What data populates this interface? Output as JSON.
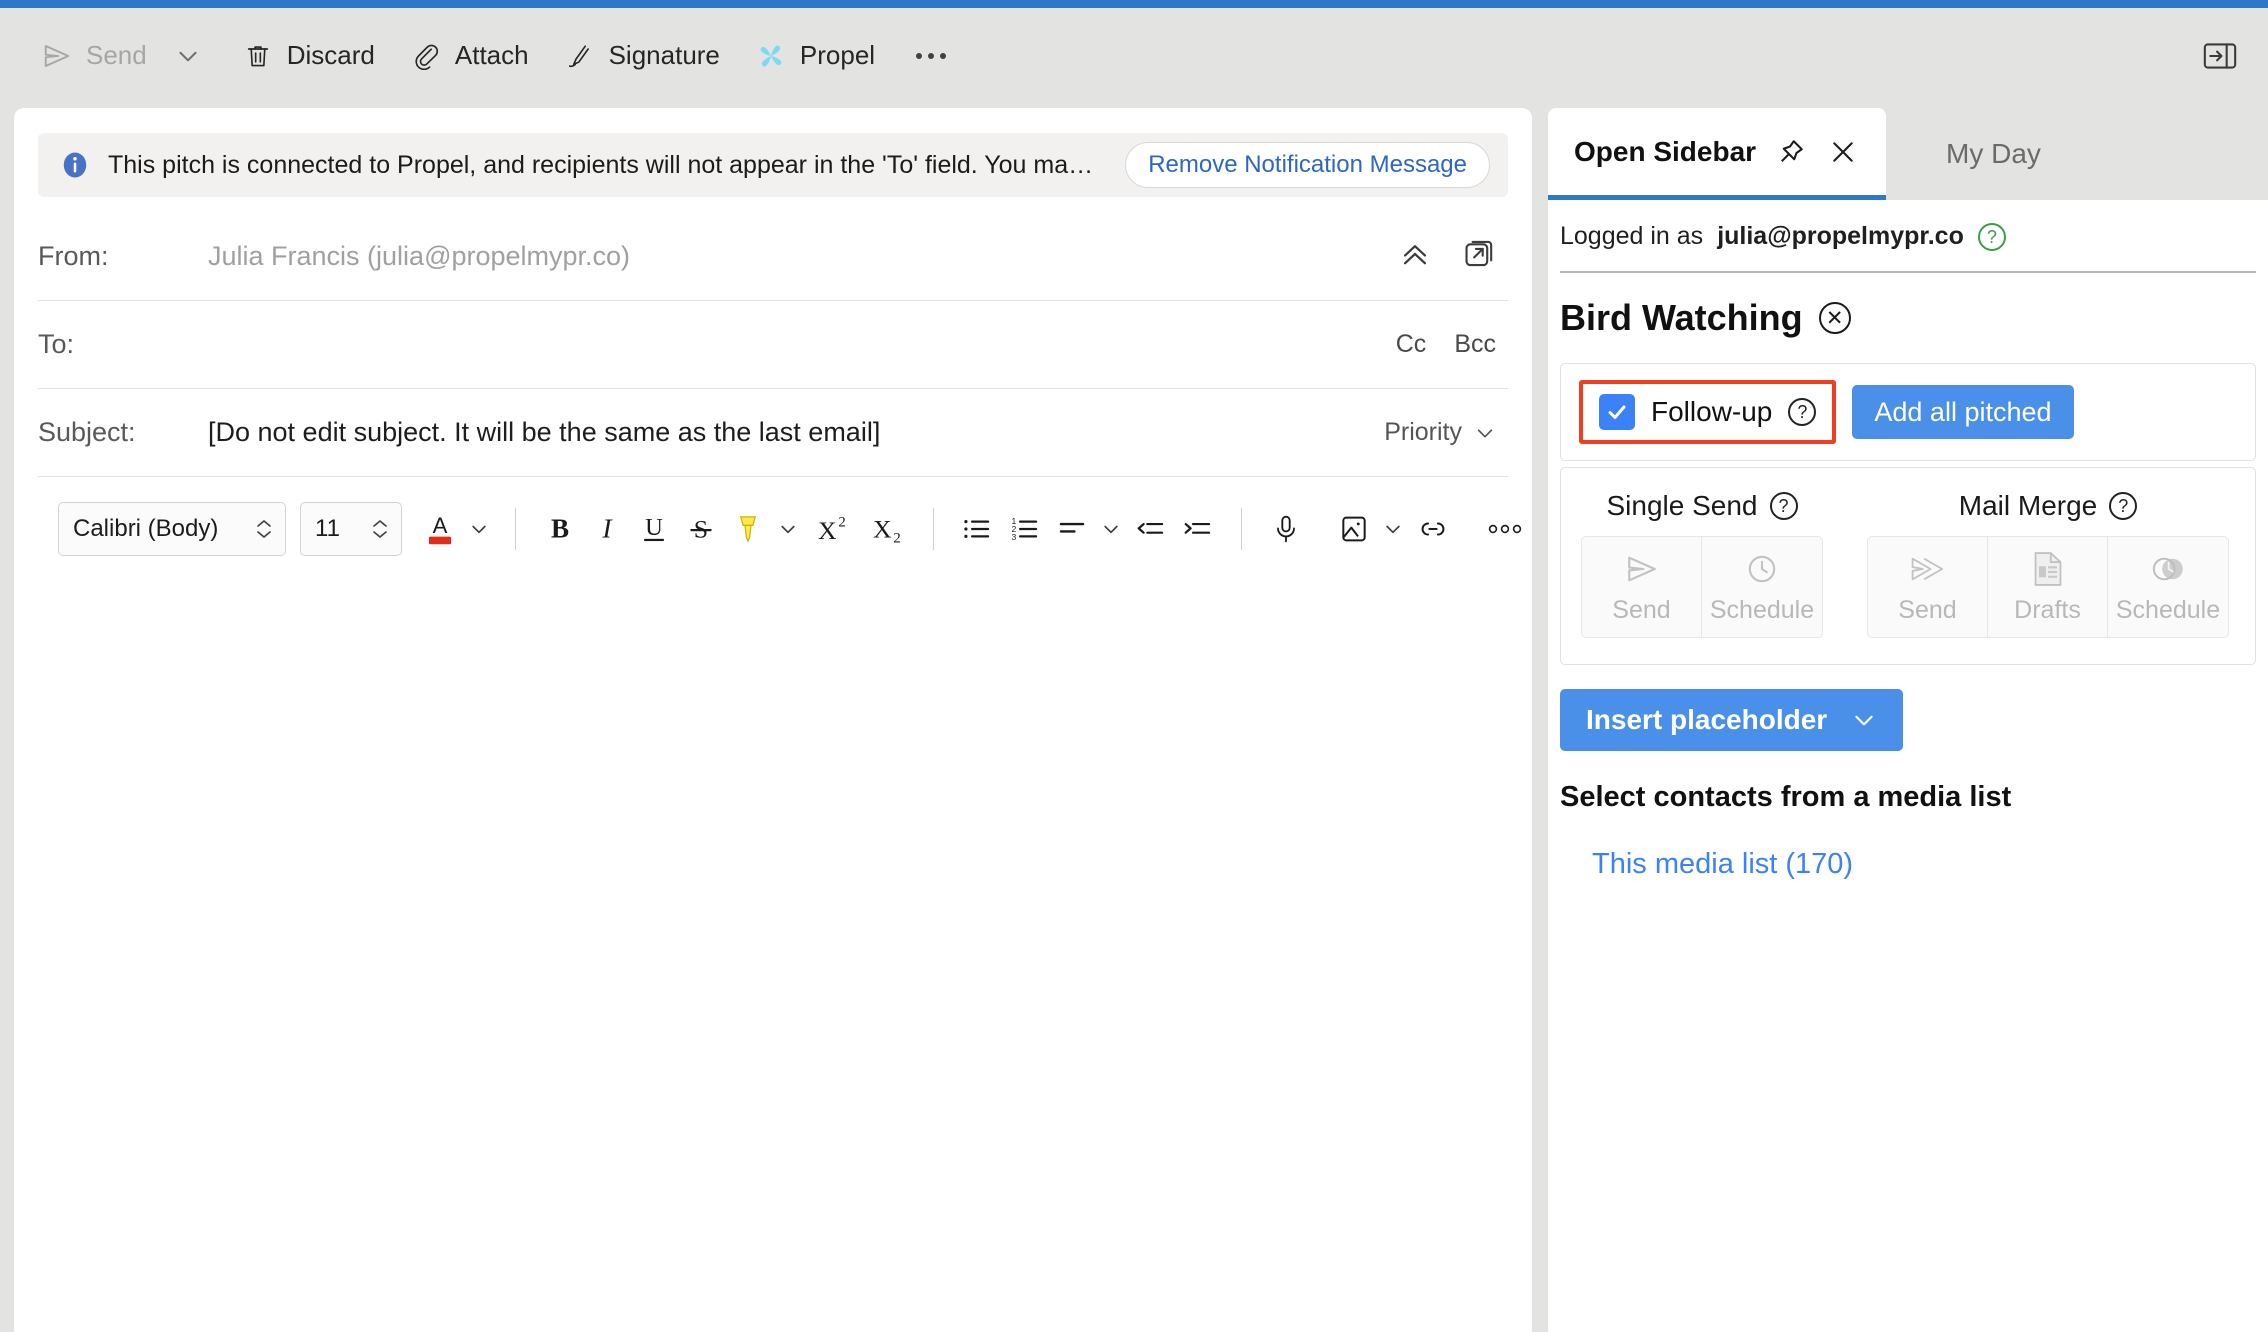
{
  "window": {
    "accent_color": "#2e78c7",
    "toolbar_bg": "#e3e4e2"
  },
  "command_bar": {
    "items": [
      {
        "label": "Send",
        "icon": "send-icon",
        "disabled": true
      },
      {
        "label": "Discard",
        "icon": "trash-icon",
        "disabled": false
      },
      {
        "label": "Attach",
        "icon": "paperclip-icon",
        "disabled": false
      },
      {
        "label": "Signature",
        "icon": "signature-pen-icon",
        "disabled": false
      },
      {
        "label": "Propel",
        "icon": "propel-pinwheel-icon",
        "disabled": false
      }
    ],
    "overflow_label": "•••",
    "send_caret_icon": "chevron-down-icon",
    "panel_toggle_icon": "open-in-side-panel-icon"
  },
  "compose": {
    "notice": {
      "icon": "info-icon",
      "message": "This pitch is connected to Propel, and recipients will not appear in the 'To' field. You ma…",
      "action_label": "Remove Notification Message",
      "action_color": "#2e66c4"
    },
    "fields": {
      "from_label": "From:",
      "from_value": "Julia Francis (julia@propelmypr.co)",
      "to_label": "To:",
      "to_value": "",
      "cc_label": "Cc",
      "bcc_label": "Bcc",
      "subject_label": "Subject:",
      "subject_value": "[Do not edit subject. It will be the same as the last email]",
      "priority_label": "Priority",
      "collapse_icon": "chevron-double-up-icon",
      "popout_icon": "pop-out-icon"
    },
    "format_toolbar": {
      "font_family": "Calibri (Body)",
      "font_size": "11",
      "buttons": [
        {
          "name": "font-color-button",
          "glyph": "A"
        },
        {
          "name": "bold-button",
          "glyph": "B"
        },
        {
          "name": "italic-button",
          "glyph": "I"
        },
        {
          "name": "underline-button",
          "glyph": "U"
        },
        {
          "name": "strikethrough-button",
          "glyph": "S"
        },
        {
          "name": "highlight-button",
          "glyph": "✐"
        },
        {
          "name": "superscript-button",
          "glyph": "X²"
        },
        {
          "name": "subscript-button",
          "glyph": "X₂"
        },
        {
          "name": "bulleted-list-button",
          "glyph": "☰"
        },
        {
          "name": "numbered-list-button",
          "glyph": "☰"
        },
        {
          "name": "align-button",
          "glyph": "≡"
        },
        {
          "name": "decrease-indent-button",
          "glyph": "⇤"
        },
        {
          "name": "increase-indent-button",
          "glyph": "⇥"
        },
        {
          "name": "dictate-button",
          "glyph": "Ἲ4"
        },
        {
          "name": "insert-picture-button",
          "glyph": "ὛC"
        },
        {
          "name": "insert-link-button",
          "glyph": "ὑ7"
        },
        {
          "name": "more-formatting-button",
          "glyph": "•••"
        }
      ]
    },
    "body_text": ""
  },
  "sidebar": {
    "tabs": [
      {
        "label": "Open Sidebar",
        "active": true,
        "pin_icon": "pin-icon",
        "close_icon": "close-icon"
      },
      {
        "label": "My Day",
        "active": false
      }
    ],
    "logged_in_prefix": "Logged in as",
    "logged_in_email": "julia@propelmypr.co",
    "logged_in_help_icon": "help-circle-icon",
    "campaign_name": "Bird Watching",
    "campaign_clear_icon": "clear-circle-icon",
    "followup": {
      "checked": true,
      "label": "Follow-up",
      "help_icon": "help-circle-icon",
      "highlight_color": "#f03e21",
      "add_all_label": "Add all pitched",
      "add_all_color": "#4a90e8"
    },
    "send_groups": [
      {
        "title": "Single Send",
        "help_icon": "help-circle-icon",
        "buttons": [
          {
            "label": "Send",
            "icon": "send-icon",
            "disabled": true
          },
          {
            "label": "Schedule",
            "icon": "clock-icon",
            "disabled": true
          }
        ]
      },
      {
        "title": "Mail Merge",
        "help_icon": "help-circle-icon",
        "buttons": [
          {
            "label": "Send",
            "icon": "send-double-icon",
            "disabled": true
          },
          {
            "label": "Drafts",
            "icon": "document-icon",
            "disabled": true
          },
          {
            "label": "Schedule",
            "icon": "merge-clock-icon",
            "disabled": true
          }
        ]
      }
    ],
    "insert_placeholder_label": "Insert placeholder",
    "insert_placeholder_caret": "chevron-down-icon",
    "select_contacts_title": "Select contacts from a media list",
    "media_list_link": "This media list (170)",
    "link_color": "#3b82f6"
  }
}
